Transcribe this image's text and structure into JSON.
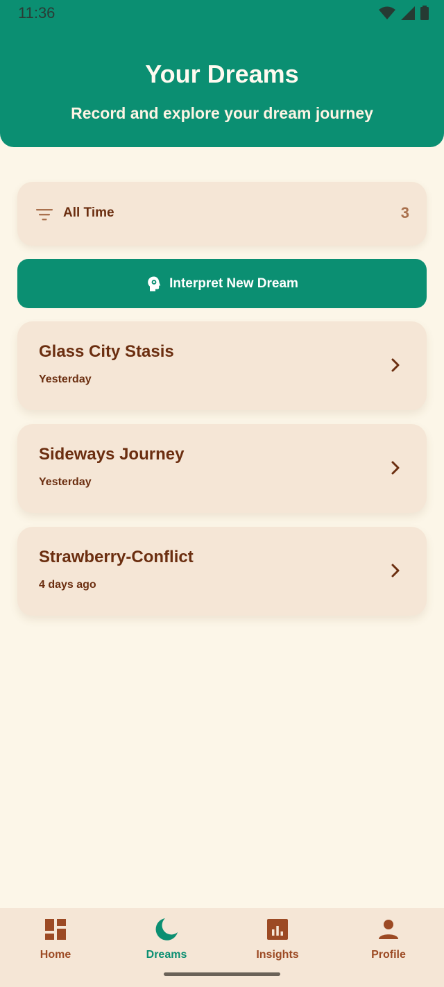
{
  "status_bar": {
    "time": "11:36"
  },
  "header": {
    "title": "Your Dreams",
    "subtitle": "Record and explore your dream journey"
  },
  "filter": {
    "label": "All Time",
    "count": "3"
  },
  "interpret_button": {
    "label": "Interpret New Dream"
  },
  "dreams": [
    {
      "title": "Glass City Stasis",
      "date": "Yesterday"
    },
    {
      "title": "Sideways Journey",
      "date": "Yesterday"
    },
    {
      "title": "Strawberry-Conflict",
      "date": "4 days ago"
    }
  ],
  "nav": [
    {
      "label": "Home",
      "icon": "dashboard-icon",
      "active": false
    },
    {
      "label": "Dreams",
      "icon": "moon-icon",
      "active": true
    },
    {
      "label": "Insights",
      "icon": "chart-icon",
      "active": false
    },
    {
      "label": "Profile",
      "icon": "person-icon",
      "active": false
    }
  ],
  "colors": {
    "primary": "#0b8f72",
    "background": "#fcf6e8",
    "card": "#f5e6d6",
    "text": "#6b2e10",
    "accent": "#9c4a24"
  }
}
